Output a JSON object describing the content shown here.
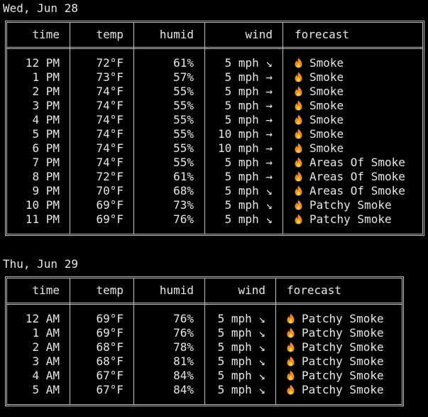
{
  "colors": {
    "background": "#000000",
    "text": "#e6e6e6",
    "border": "#bdbdbd",
    "fire_outer": "#f28b1e",
    "fire_inner": "#ffd23f"
  },
  "days": [
    {
      "label": "Wed, Jun 28",
      "headers": {
        "time": "time",
        "temp": "temp",
        "humid": "humid",
        "wind": "wind",
        "forecast": "forecast"
      },
      "rows": [
        {
          "time": "12 PM",
          "temp": "72°F",
          "humid": "61%",
          "wind": "5 mph ↘",
          "icon": "fire-icon",
          "forecast": "Smoke"
        },
        {
          "time": "1 PM",
          "temp": "73°F",
          "humid": "57%",
          "wind": "5 mph →",
          "icon": "fire-icon",
          "forecast": "Smoke"
        },
        {
          "time": "2 PM",
          "temp": "74°F",
          "humid": "55%",
          "wind": "5 mph →",
          "icon": "fire-icon",
          "forecast": "Smoke"
        },
        {
          "time": "3 PM",
          "temp": "74°F",
          "humid": "55%",
          "wind": "5 mph →",
          "icon": "fire-icon",
          "forecast": "Smoke"
        },
        {
          "time": "4 PM",
          "temp": "74°F",
          "humid": "55%",
          "wind": "5 mph →",
          "icon": "fire-icon",
          "forecast": "Smoke"
        },
        {
          "time": "5 PM",
          "temp": "74°F",
          "humid": "55%",
          "wind": "10 mph →",
          "icon": "fire-icon",
          "forecast": "Smoke"
        },
        {
          "time": "6 PM",
          "temp": "74°F",
          "humid": "55%",
          "wind": "10 mph →",
          "icon": "fire-icon",
          "forecast": "Smoke"
        },
        {
          "time": "7 PM",
          "temp": "74°F",
          "humid": "55%",
          "wind": "5 mph →",
          "icon": "fire-icon",
          "forecast": "Areas Of Smoke"
        },
        {
          "time": "8 PM",
          "temp": "72°F",
          "humid": "61%",
          "wind": "5 mph →",
          "icon": "fire-icon",
          "forecast": "Areas Of Smoke"
        },
        {
          "time": "9 PM",
          "temp": "70°F",
          "humid": "68%",
          "wind": "5 mph ↘",
          "icon": "fire-icon",
          "forecast": "Areas Of Smoke"
        },
        {
          "time": "10 PM",
          "temp": "69°F",
          "humid": "73%",
          "wind": "5 mph ↘",
          "icon": "fire-icon",
          "forecast": "Patchy Smoke"
        },
        {
          "time": "11 PM",
          "temp": "69°F",
          "humid": "76%",
          "wind": "5 mph ↘",
          "icon": "fire-icon",
          "forecast": "Patchy Smoke"
        }
      ]
    },
    {
      "label": "Thu, Jun 29",
      "headers": {
        "time": "time",
        "temp": "temp",
        "humid": "humid",
        "wind": "wind",
        "forecast": "forecast"
      },
      "rows": [
        {
          "time": "12 AM",
          "temp": "69°F",
          "humid": "76%",
          "wind": "5 mph ↘",
          "icon": "fire-icon",
          "forecast": "Patchy Smoke"
        },
        {
          "time": "1 AM",
          "temp": "69°F",
          "humid": "76%",
          "wind": "5 mph ↘",
          "icon": "fire-icon",
          "forecast": "Patchy Smoke"
        },
        {
          "time": "2 AM",
          "temp": "68°F",
          "humid": "78%",
          "wind": "5 mph ↘",
          "icon": "fire-icon",
          "forecast": "Patchy Smoke"
        },
        {
          "time": "3 AM",
          "temp": "68°F",
          "humid": "81%",
          "wind": "5 mph ↘",
          "icon": "fire-icon",
          "forecast": "Patchy Smoke"
        },
        {
          "time": "4 AM",
          "temp": "67°F",
          "humid": "84%",
          "wind": "5 mph ↘",
          "icon": "fire-icon",
          "forecast": "Patchy Smoke"
        },
        {
          "time": "5 AM",
          "temp": "67°F",
          "humid": "84%",
          "wind": "5 mph ↘",
          "icon": "fire-icon",
          "forecast": "Patchy Smoke"
        }
      ]
    }
  ]
}
